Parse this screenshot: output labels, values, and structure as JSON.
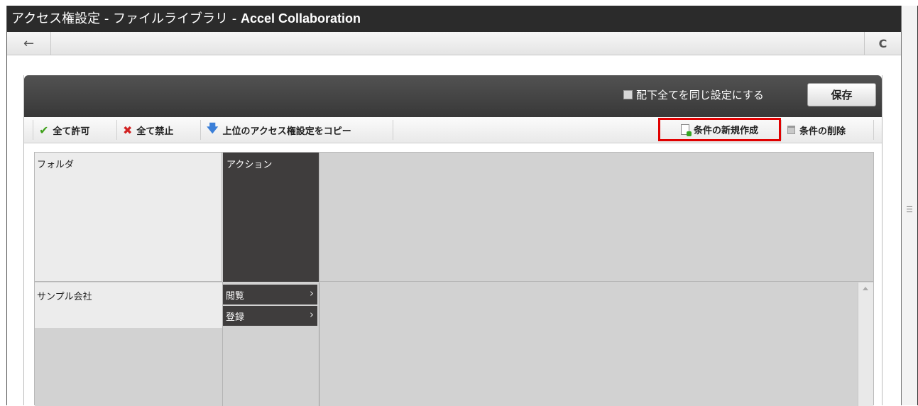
{
  "window": {
    "title_prefix": "アクセス権設定 - ファイルライブラリ - ",
    "title_app": "Accel Collaboration"
  },
  "nav": {
    "back_glyph": "←",
    "reload_glyph": "C"
  },
  "header": {
    "same_setting_label": "配下全てを同じ設定にする",
    "same_setting_checked": false,
    "save_label": "保存"
  },
  "toolbar": {
    "allow_all": "全て許可",
    "deny_all": "全て禁止",
    "copy_parent": "上位のアクセス権設定をコピー",
    "new_condition": "条件の新規作成",
    "delete_condition": "条件の削除"
  },
  "grid": {
    "folder_header": "フォルダ",
    "action_header": "アクション",
    "rows": [
      {
        "name": "サンプル会社",
        "actions": [
          "閲覧",
          "登録"
        ]
      }
    ]
  },
  "colors": {
    "highlight": "#e00000",
    "titlebar": "#2b2b2b",
    "panel_head": "#444444"
  },
  "icons": {
    "allow": "check-icon",
    "deny": "x-icon",
    "copy": "arrow-down-icon",
    "new": "new-document-icon",
    "delete": "trash-icon"
  }
}
